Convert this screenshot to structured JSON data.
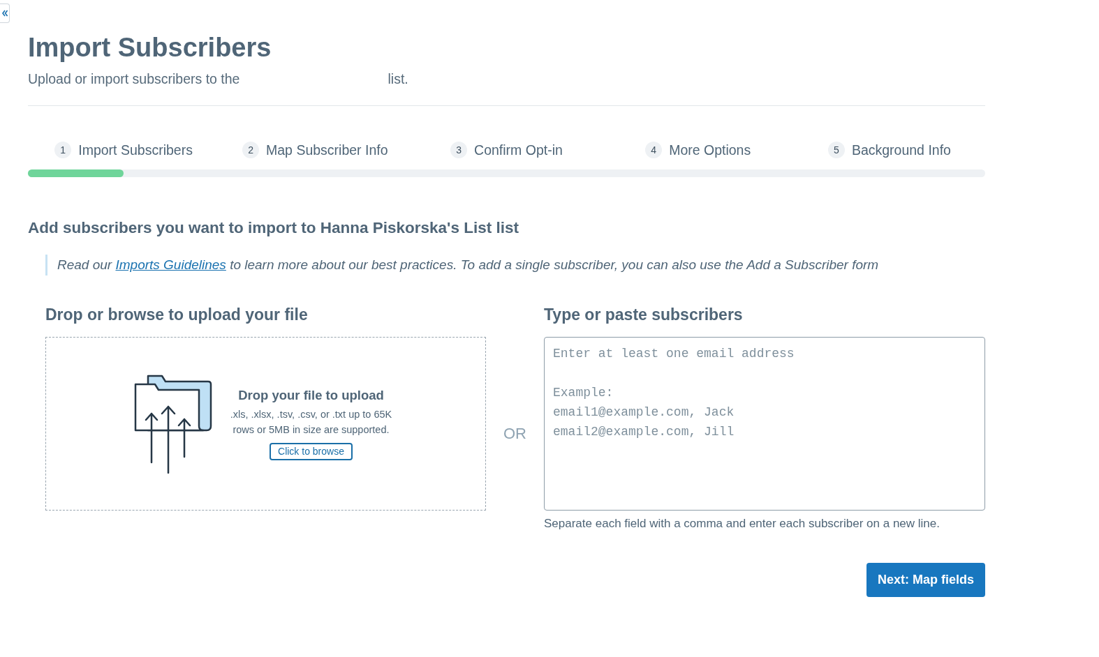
{
  "page": {
    "title": "Import Subscribers",
    "subtitle": [
      "Upload or import subscribers to the",
      "list."
    ]
  },
  "steps": [
    {
      "number": "1",
      "label": "Import Subscribers"
    },
    {
      "number": "2",
      "label": "Map Subscriber Info"
    },
    {
      "number": "3",
      "label": "Confirm Opt-in"
    },
    {
      "number": "4",
      "label": "More Options"
    },
    {
      "number": "5",
      "label": "Background Info"
    }
  ],
  "progress": {
    "level": 0.1
  },
  "section": {
    "heading": "Add subscribers you want to import to Hanna Piskorska's List list",
    "note": {
      "before": "Read our",
      "link": "Imports Guidelines",
      "after": "to learn more about our best practices. To add a single subscriber, you can also use the Add a Subscriber form"
    }
  },
  "upload": {
    "heading": "Drop or browse to upload your file",
    "title": "Drop your file to upload",
    "description": [
      ".xls, .xlsx, .tsv, .csv, or .txt up to 65K",
      "rows or 5MB in size are supported."
    ],
    "button": "Click to browse"
  },
  "separator": "OR",
  "paste": {
    "heading": "Type or paste subscribers",
    "placeholder": "Enter at least one email address\n\nExample:\nemail1@example.com, Jack\nemail2@example.com, Jill",
    "hint": "Separate each field with a comma and enter each subscriber on a new line."
  },
  "next_button": "Next: Map fields"
}
